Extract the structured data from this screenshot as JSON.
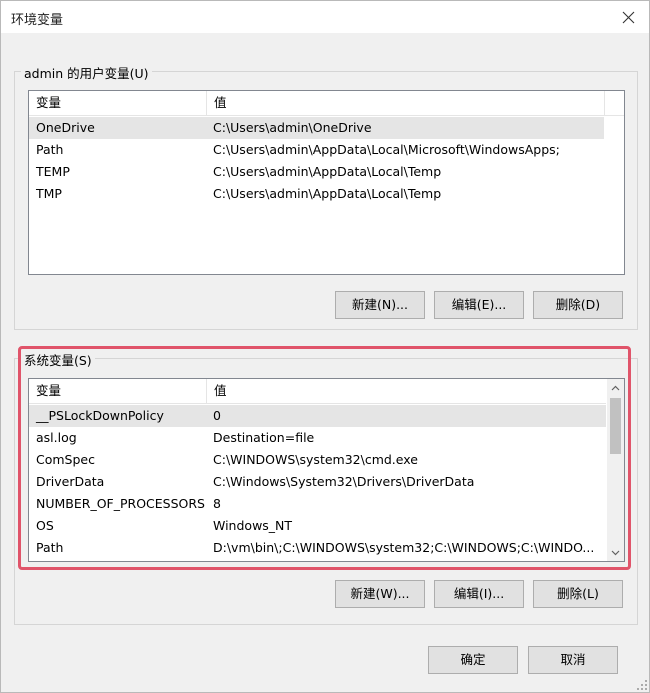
{
  "window": {
    "title": "环境变量"
  },
  "user_vars": {
    "group_title": "admin 的用户变量(U)",
    "headers": {
      "name": "变量",
      "value": "值"
    },
    "rows": [
      {
        "name": "OneDrive",
        "value": "C:\\Users\\admin\\OneDrive",
        "selected": true
      },
      {
        "name": "Path",
        "value": "C:\\Users\\admin\\AppData\\Local\\Microsoft\\WindowsApps;"
      },
      {
        "name": "TEMP",
        "value": "C:\\Users\\admin\\AppData\\Local\\Temp"
      },
      {
        "name": "TMP",
        "value": "C:\\Users\\admin\\AppData\\Local\\Temp"
      }
    ],
    "buttons": {
      "new": "新建(N)...",
      "edit": "编辑(E)...",
      "delete": "删除(D)"
    }
  },
  "system_vars": {
    "group_title": "系统变量(S)",
    "headers": {
      "name": "变量",
      "value": "值"
    },
    "rows": [
      {
        "name": "__PSLockDownPolicy",
        "value": "0",
        "selected": true
      },
      {
        "name": "asl.log",
        "value": "Destination=file"
      },
      {
        "name": "ComSpec",
        "value": "C:\\WINDOWS\\system32\\cmd.exe"
      },
      {
        "name": "DriverData",
        "value": "C:\\Windows\\System32\\Drivers\\DriverData"
      },
      {
        "name": "NUMBER_OF_PROCESSORS",
        "value": "8"
      },
      {
        "name": "OS",
        "value": "Windows_NT"
      },
      {
        "name": "Path",
        "value": "D:\\vm\\bin\\;C:\\WINDOWS\\system32;C:\\WINDOWS;C:\\WINDO..."
      }
    ],
    "buttons": {
      "new": "新建(W)...",
      "edit": "编辑(I)...",
      "delete": "删除(L)"
    }
  },
  "footer": {
    "ok": "确定",
    "cancel": "取消"
  },
  "colors": {
    "highlight": "#e0546a",
    "selected_row": "#e5e5e5"
  },
  "icons": {
    "close": "close-icon",
    "scroll_up": "chevron-up-icon",
    "scroll_down": "chevron-down-icon",
    "resize": "resize-grip-icon"
  }
}
